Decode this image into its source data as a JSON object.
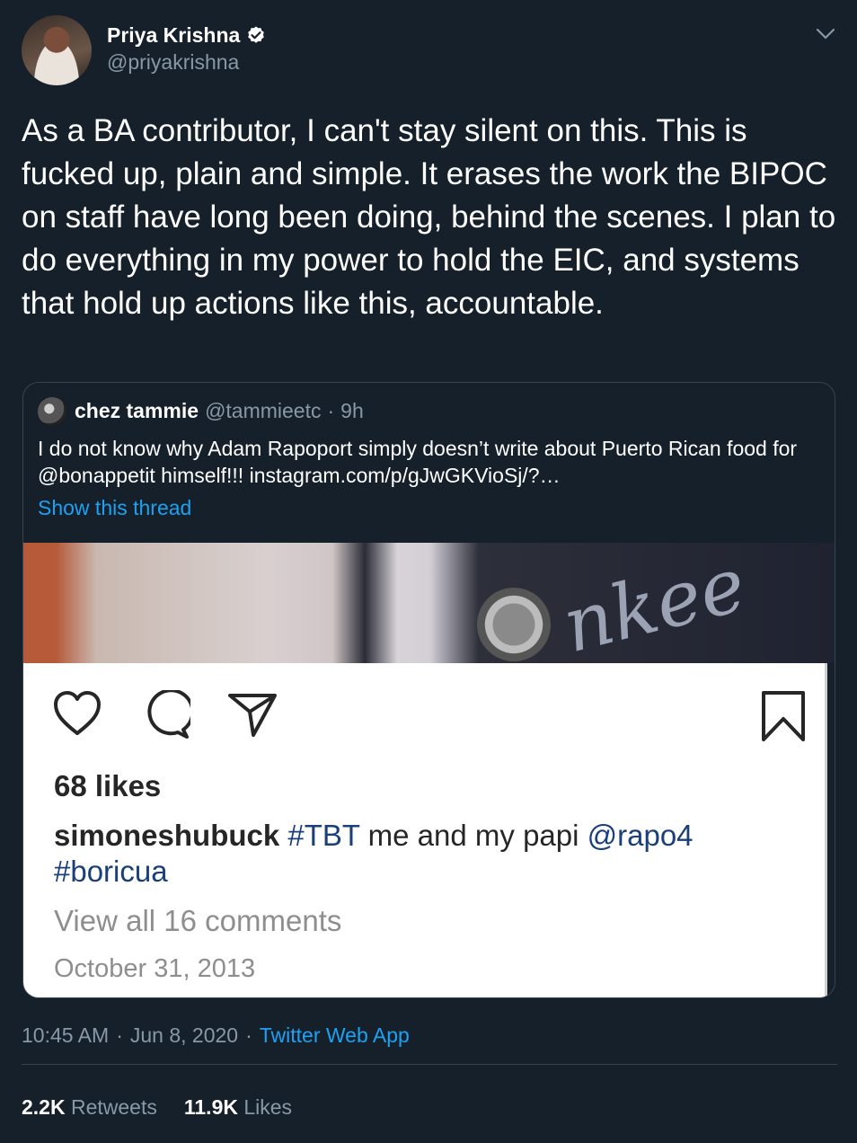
{
  "author": {
    "name": "Priya Krishna",
    "handle": "@priyakrishna",
    "icons": [
      "avatar",
      "verified-badge-icon",
      "chevron-down-icon"
    ]
  },
  "tweet": {
    "text": "As a BA contributor, I can't stay silent on this. This is fucked up, plain and simple. It erases the work the BIPOC on staff have long been doing, behind the scenes. I plan to do everything in my power to hold the EIC, and systems that hold up actions like this, accountable."
  },
  "quote": {
    "name": "chez tammie",
    "handle": "@tammieetc",
    "separator": "·",
    "time": "9h",
    "text": "I do not know why Adam Rapoport simply doesn’t write about Puerto Rican food for @bonappetit himself!!! instagram.com/p/gJwGKVioSj/?…",
    "show_thread": "Show this thread"
  },
  "instagram": {
    "photo_text": "nkee",
    "likes": "68 likes",
    "username": "simoneshubuck",
    "tag1": "#TBT",
    "caption_mid": " me and my papi ",
    "mention": "@rapo4",
    "tag2": "#boricua",
    "comments": "View all 16 comments",
    "date": "October 31, 2013",
    "icons": [
      "heart-icon",
      "comment-icon",
      "share-icon",
      "bookmark-icon"
    ]
  },
  "meta": {
    "time": "10:45 AM",
    "separator": "·",
    "date": "Jun 8, 2020",
    "app": "Twitter Web App"
  },
  "stats": {
    "retweets_count": "2.2K",
    "retweets_label": "Retweets",
    "likes_count": "11.9K",
    "likes_label": "Likes"
  },
  "colors": {
    "background": "#15202b",
    "link": "#1da1f2",
    "secondary": "#8899a6",
    "border": "#38444d"
  }
}
